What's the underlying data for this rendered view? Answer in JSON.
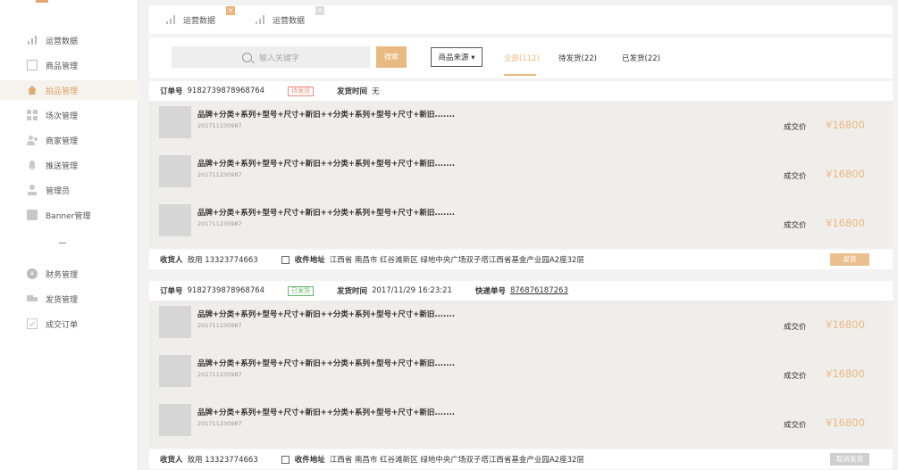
{
  "sidebar": {
    "items": [
      {
        "label": "运营数据",
        "icon": "bar-chart-icon",
        "active": false
      },
      {
        "label": "商品管理",
        "icon": "product-box-icon",
        "active": false
      },
      {
        "label": "拍品管理",
        "icon": "home-icon",
        "active": true
      },
      {
        "label": "场次管理",
        "icon": "grid-icon",
        "active": false
      },
      {
        "label": "商家管理",
        "icon": "merchants-icon",
        "active": false
      },
      {
        "label": "推送管理",
        "icon": "bell-icon",
        "active": false
      },
      {
        "label": "管理员",
        "icon": "admin-icon",
        "active": false
      },
      {
        "label": "Banner管理",
        "icon": "banner-icon",
        "active": false
      },
      {
        "label": "财务管理",
        "icon": "finance-coin-icon",
        "active": false
      },
      {
        "label": "发货管理",
        "icon": "truck-icon",
        "active": false
      },
      {
        "label": "成交订单",
        "icon": "checkbox-icon",
        "active": false
      }
    ]
  },
  "tabs": [
    {
      "label": "运营数据",
      "close": "×"
    },
    {
      "label": "运营数据",
      "close": "×"
    }
  ],
  "toolbar": {
    "search_placeholder": "输入关键字",
    "search_button": "搜索",
    "source_select": "商品来源 ▾",
    "filters": [
      {
        "label": "全部(112)",
        "active": true
      },
      {
        "label": "待发货(22)",
        "active": false
      },
      {
        "label": "已发货(22)",
        "active": false
      }
    ]
  },
  "labels": {
    "order_no": "订单号",
    "ship_time": "发货时间",
    "tracking": "快递单号",
    "receiver": "收货人",
    "address": "收件地址",
    "deal_price": "成交价"
  },
  "orders": [
    {
      "order_no": "9182739878968764",
      "status": "待发货",
      "ship_time": "无",
      "tracking_no": "",
      "items": [
        {
          "title": "品牌+分类+系列+型号+尺寸+新旧++分类+系列+型号+尺寸+新旧.......",
          "sku": "201711230987",
          "price": "¥16800"
        },
        {
          "title": "品牌+分类+系列+型号+尺寸+新旧++分类+系列+型号+尺寸+新旧.......",
          "sku": "201711230987",
          "price": "¥16800"
        },
        {
          "title": "品牌+分类+系列+型号+尺寸+新旧++分类+系列+型号+尺寸+新旧.......",
          "sku": "201711230987",
          "price": "¥16800"
        }
      ],
      "receiver": "敖用 13323774663",
      "address": "江西省 南昌市 红谷滩新区 绿地中央广场双子塔江西省基金产业园A2座32层",
      "action": "发货"
    },
    {
      "order_no": "9182739878968764",
      "status": "已发货",
      "ship_time": "2017/11/29 16:23:21",
      "tracking_no": "876876187263",
      "items": [
        {
          "title": "品牌+分类+系列+型号+尺寸+新旧++分类+系列+型号+尺寸+新旧.......",
          "sku": "201711230987",
          "price": "¥16800"
        },
        {
          "title": "品牌+分类+系列+型号+尺寸+新旧++分类+系列+型号+尺寸+新旧.......",
          "sku": "201711230987",
          "price": "¥16800"
        },
        {
          "title": "品牌+分类+系列+型号+尺寸+新旧++分类+系列+型号+尺寸+新旧.......",
          "sku": "201711230987",
          "price": "¥16800"
        }
      ],
      "receiver": "敖用 13323774663",
      "address": "江西省 南昌市 红谷滩新区 绿地中央广场双子塔江西省基金产业园A2座32层",
      "action": "取消发货"
    }
  ],
  "colors": {
    "accent": "#e9b982",
    "active_side": "#d9a15f",
    "item_bg": "#f0eeea",
    "pending_badge": "#f08b7a",
    "shipped_badge": "#62b86a"
  }
}
